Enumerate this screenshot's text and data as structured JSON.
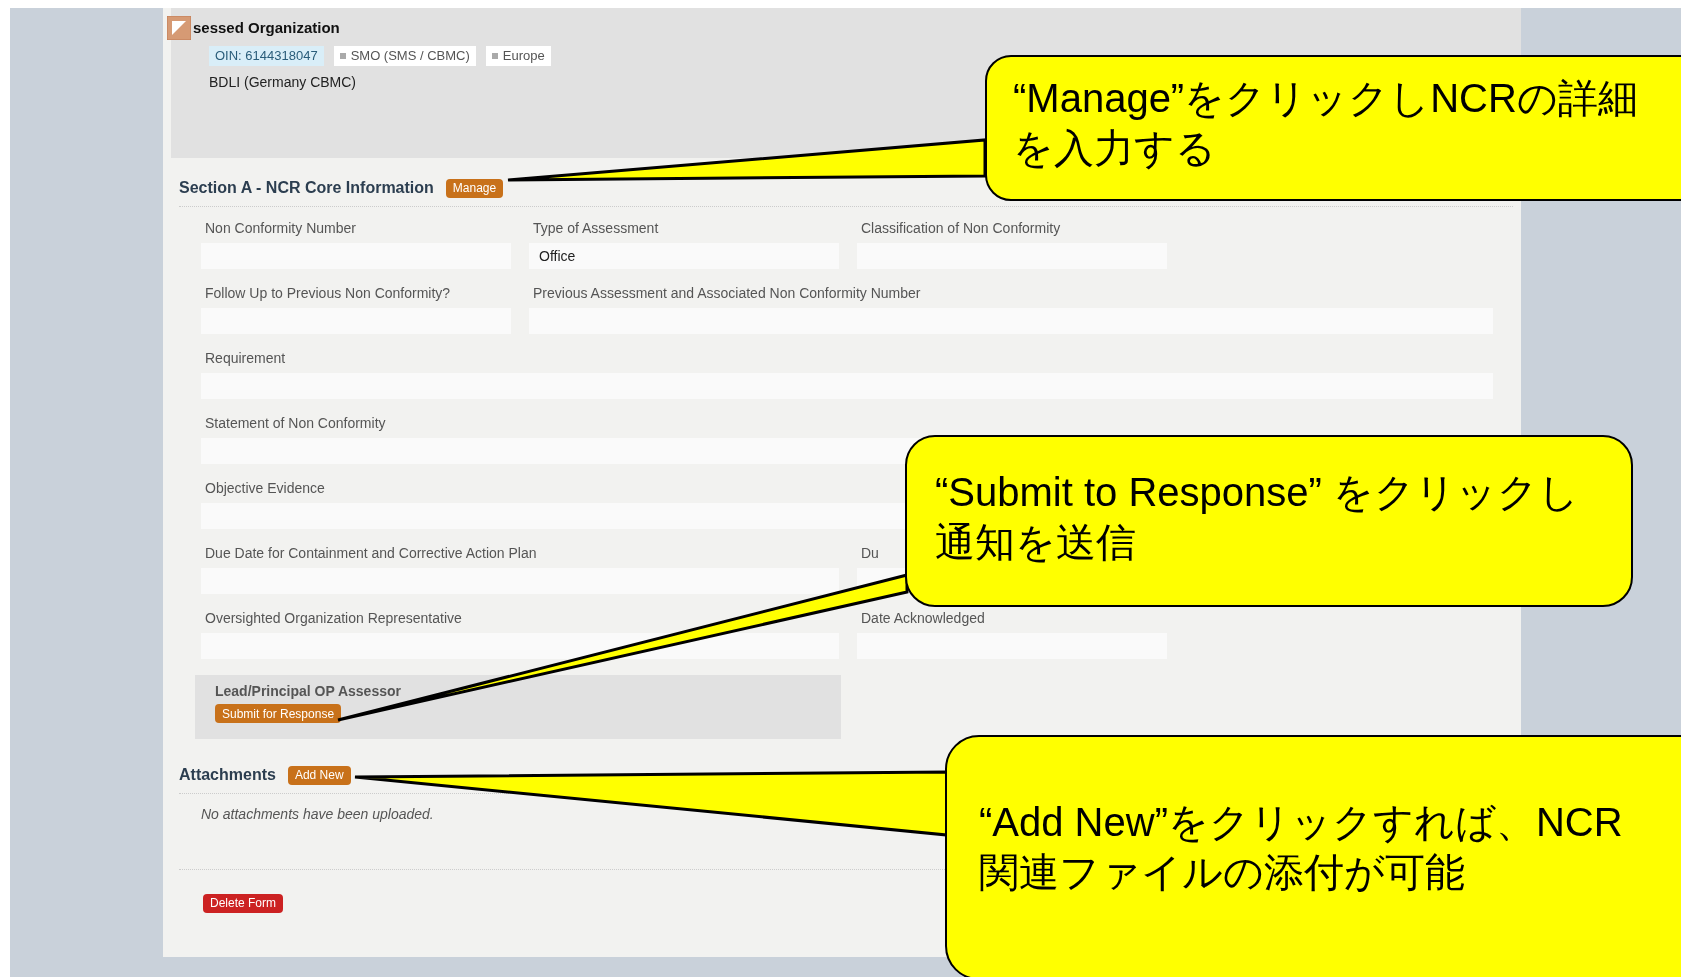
{
  "header": {
    "title": "sessed Organization",
    "tags": [
      {
        "text": "OIN: 6144318047",
        "kind": "id"
      },
      {
        "text": "SMO (SMS / CBMC)",
        "kind": "category"
      },
      {
        "text": "Europe",
        "kind": "category"
      }
    ],
    "subtitle": "BDLI (Germany CBMC)"
  },
  "section": {
    "title": "Section A - NCR Core Information",
    "button": "Manage"
  },
  "fields": [
    {
      "label": "Non Conformity Number",
      "kind": "narrow"
    },
    {
      "label": "Type of Assessment",
      "kind": "narrow",
      "value": "Office"
    },
    {
      "label": "Classification of Non Conformity",
      "kind": "narrow"
    },
    {
      "kind": "gap"
    },
    {
      "label": "Follow Up to Previous Non Conformity?",
      "kind": "narrow"
    },
    {
      "label": "Previous Assessment and Associated Non Conformity Number",
      "kind": "wide"
    },
    {
      "label": "Requirement",
      "kind": "full"
    },
    {
      "label": "Statement of Non Conformity",
      "kind": "full"
    },
    {
      "label": "Objective Evidence",
      "kind": "full"
    },
    {
      "label": "Due Date for Containment and Corrective Action Plan",
      "kind": "double"
    },
    {
      "label": "Du",
      "kind": "narrow"
    },
    {
      "kind": "gap"
    },
    {
      "label": "Oversighted Organization Representative",
      "kind": "double"
    },
    {
      "label": "Date Acknowledged",
      "kind": "narrow"
    },
    {
      "kind": "gap"
    }
  ],
  "lead": {
    "label": "Lead/Principal OP Assessor",
    "button": "Submit for Response"
  },
  "attachments": {
    "title": "Attachments",
    "button": "Add New",
    "empty_text": "No attachments have been uploaded."
  },
  "delete_button": "Delete Form",
  "callouts": [
    {
      "lines": [
        "“Manage”をクリックしNCRの詳細",
        "を入力する"
      ]
    },
    {
      "lines": [
        "“Submit to Response” をクリックし",
        "通知を送信"
      ]
    },
    {
      "lines": [
        "“Add New”をクリックすれば、NCR",
        "関連ファイルの添付が可能"
      ]
    }
  ]
}
